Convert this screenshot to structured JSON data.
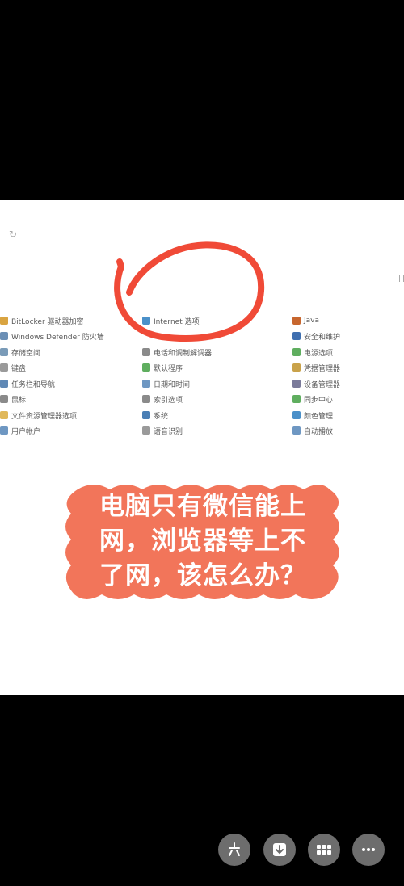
{
  "control_panel": {
    "col1": [
      {
        "label": "BitLocker 驱动器加密",
        "icon": "bitlocker-icon",
        "color": "#d9a441"
      },
      {
        "label": "Windows Defender 防火墙",
        "icon": "firewall-icon",
        "color": "#6b8fb5"
      },
      {
        "label": "存储空间",
        "icon": "storage-icon",
        "color": "#7a9bb8"
      },
      {
        "label": "键盘",
        "icon": "keyboard-icon",
        "color": "#9a9a9a"
      },
      {
        "label": "任务栏和导航",
        "icon": "taskbar-icon",
        "color": "#5f88b5"
      },
      {
        "label": "鼠标",
        "icon": "mouse-icon",
        "color": "#8a8a8a"
      },
      {
        "label": "文件资源管理器选项",
        "icon": "folder-icon",
        "color": "#e0b85a"
      },
      {
        "label": "用户帐户",
        "icon": "user-accounts-icon",
        "color": "#6e97c2"
      }
    ],
    "col2": [
      {
        "label": "Internet 选项",
        "icon": "internet-options-icon",
        "color": "#4a90c9"
      },
      {
        "label": "电话和调制解调器",
        "icon": "phone-modem-icon",
        "color": "#8a8a8a"
      },
      {
        "label": "默认程序",
        "icon": "default-programs-icon",
        "color": "#5fae5f"
      },
      {
        "label": "日期和时间",
        "icon": "date-time-icon",
        "color": "#6e97c2"
      },
      {
        "label": "索引选项",
        "icon": "indexing-icon",
        "color": "#8a8a8a"
      },
      {
        "label": "系统",
        "icon": "system-icon",
        "color": "#4a7fb5"
      },
      {
        "label": "语音识别",
        "icon": "microphone-icon",
        "color": "#9a9a9a"
      }
    ],
    "col3": [
      {
        "label": "Java",
        "icon": "java-icon",
        "color": "#c7662e"
      },
      {
        "label": "安全和维护",
        "icon": "flag-icon",
        "color": "#3f6fb0"
      },
      {
        "label": "电源选项",
        "icon": "power-icon",
        "color": "#5fae5f"
      },
      {
        "label": "凭据管理器",
        "icon": "credential-icon",
        "color": "#c9a24a"
      },
      {
        "label": "设备管理器",
        "icon": "device-manager-icon",
        "color": "#7a7a9a"
      },
      {
        "label": "同步中心",
        "icon": "sync-icon",
        "color": "#5fae5f"
      },
      {
        "label": "颜色管理",
        "icon": "color-icon",
        "color": "#4a90c9"
      },
      {
        "label": "自动播放",
        "icon": "autoplay-icon",
        "color": "#6e97c2"
      }
    ]
  },
  "banner": {
    "text_lines": [
      "电脑只有微信能上",
      "网，浏览器等上不",
      "了网，该怎么办？"
    ],
    "bg_color": "#f2755a",
    "text_color": "#ffffff"
  },
  "annotation": {
    "color": "#f04a37"
  },
  "toolbar": {
    "buttons": [
      {
        "icon": "share-icon"
      },
      {
        "icon": "download-icon"
      },
      {
        "icon": "grid-icon"
      },
      {
        "icon": "more-icon"
      }
    ]
  }
}
